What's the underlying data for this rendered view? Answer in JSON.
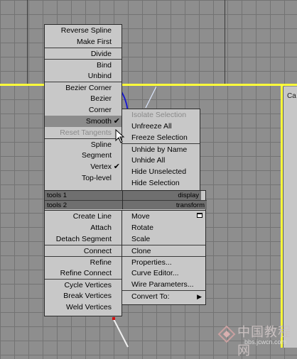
{
  "viewport": {
    "side_label": "Ca"
  },
  "quad_left_top": {
    "items": [
      {
        "label": "Reverse Spline",
        "state": "normal"
      },
      {
        "label": "Make First",
        "state": "normal"
      },
      {
        "label": "Divide",
        "state": "normal",
        "sep": true
      },
      {
        "label": "Bind",
        "state": "normal",
        "sep": true
      },
      {
        "label": "Unbind",
        "state": "normal"
      },
      {
        "label": "Bezier Corner",
        "state": "normal",
        "sep": true
      },
      {
        "label": "Bezier",
        "state": "normal"
      },
      {
        "label": "Corner",
        "state": "normal"
      },
      {
        "label": "Smooth",
        "state": "highlighted",
        "checked": true
      },
      {
        "label": "Reset Tangents",
        "state": "disabled"
      },
      {
        "label": "Spline",
        "state": "normal",
        "sep": true
      },
      {
        "label": "Segment",
        "state": "normal"
      },
      {
        "label": "Vertex",
        "state": "normal",
        "checked": true
      },
      {
        "label": "Top-level",
        "state": "normal"
      }
    ],
    "header": "tools 1"
  },
  "quad_right_top": {
    "items": [
      {
        "label": "Isolate Selection",
        "state": "disabled"
      },
      {
        "label": "Unfreeze All",
        "state": "normal"
      },
      {
        "label": "Freeze Selection",
        "state": "normal"
      },
      {
        "label": "Unhide by Name",
        "state": "normal",
        "sep": true
      },
      {
        "label": "Unhide All",
        "state": "normal"
      },
      {
        "label": "Hide Unselected",
        "state": "normal"
      },
      {
        "label": "Hide Selection",
        "state": "normal"
      }
    ],
    "header": "display"
  },
  "quad_left_bottom": {
    "header": "tools 2",
    "items": [
      {
        "label": "Create Line",
        "state": "normal"
      },
      {
        "label": "Attach",
        "state": "normal"
      },
      {
        "label": "Detach Segment",
        "state": "normal"
      },
      {
        "label": "Connect",
        "state": "normal",
        "sep": true
      },
      {
        "label": "Refine",
        "state": "normal",
        "sep": true
      },
      {
        "label": "Refine Connect",
        "state": "normal"
      },
      {
        "label": "Cycle Vertices",
        "state": "normal",
        "sep": true
      },
      {
        "label": "Break Vertices",
        "state": "normal"
      },
      {
        "label": "Weld Vertices",
        "state": "normal"
      }
    ]
  },
  "quad_right_bottom": {
    "header": "transform",
    "items": [
      {
        "label": "Move",
        "state": "normal",
        "icon": "window-icon"
      },
      {
        "label": "Rotate",
        "state": "normal"
      },
      {
        "label": "Scale",
        "state": "normal"
      },
      {
        "label": "Clone",
        "state": "normal",
        "sep": true
      },
      {
        "label": "Properties...",
        "state": "normal",
        "sep": true
      },
      {
        "label": "Curve Editor...",
        "state": "normal"
      },
      {
        "label": "Wire Parameters...",
        "state": "normal"
      },
      {
        "label": "Convert To:",
        "state": "normal",
        "submenu": true,
        "sep": true
      }
    ]
  },
  "watermark": {
    "text": "中国教程网",
    "url": "bbs.jcwcn.com"
  }
}
